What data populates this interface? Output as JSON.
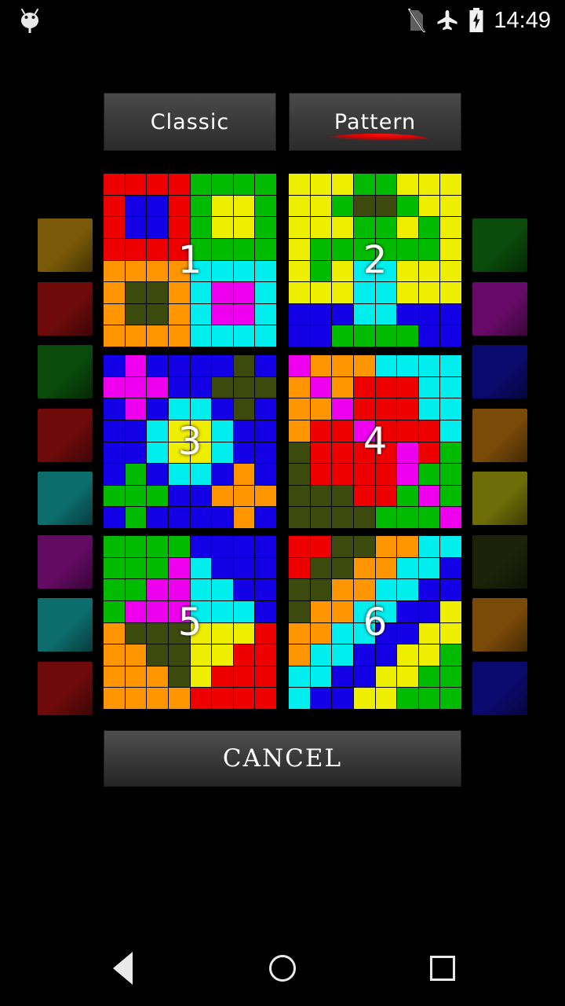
{
  "statusbar": {
    "time": "14:49",
    "icons": [
      "android-head-icon",
      "no-sim-icon",
      "airplane-mode-icon",
      "battery-charging-icon"
    ]
  },
  "tabs": [
    {
      "id": "classic",
      "label": "Classic",
      "active": false
    },
    {
      "id": "pattern",
      "label": "Pattern",
      "active": true
    }
  ],
  "footer": {
    "cancel_label": "CANCEL"
  },
  "navbar": {
    "back": "back-icon",
    "home": "home-icon",
    "recents": "recents-icon"
  },
  "colors": {
    "red": "#ee0000",
    "green": "#00bb00",
    "blue": "#1400e6",
    "yellow": "#eeee00",
    "orange": "#ff9500",
    "cyan": "#00eeee",
    "magenta": "#ee00ee",
    "olive": "#3d4a0e",
    "dark_olive": "#44500e",
    "tab_bg": "#3d3d3d",
    "accent_underline": "#d40000"
  },
  "palette_left": {
    "label": "left-color-palette",
    "swatches": [
      {
        "name": "swatch-dark-amber",
        "color": "#7a5a08"
      },
      {
        "name": "swatch-dark-red",
        "color": "#6e0a0a"
      },
      {
        "name": "swatch-dark-green",
        "color": "#0a4a0a"
      },
      {
        "name": "swatch-dark-red-2",
        "color": "#6e0a0a"
      },
      {
        "name": "swatch-teal",
        "color": "#0d6d6d"
      },
      {
        "name": "swatch-purple",
        "color": "#630a63"
      },
      {
        "name": "swatch-teal-2",
        "color": "#0d6d6d"
      },
      {
        "name": "swatch-dark-red-3",
        "color": "#6e0a0a"
      }
    ]
  },
  "palette_right": {
    "label": "right-color-palette",
    "swatches": [
      {
        "name": "swatch-dark-green",
        "color": "#0a4a0a"
      },
      {
        "name": "swatch-purple",
        "color": "#670a67"
      },
      {
        "name": "swatch-navy",
        "color": "#0a0a6e"
      },
      {
        "name": "swatch-brown",
        "color": "#7a4a08"
      },
      {
        "name": "swatch-olive-yellow",
        "color": "#6e6e08"
      },
      {
        "name": "swatch-very-dark-olive",
        "color": "#1c2208"
      },
      {
        "name": "swatch-brown-2",
        "color": "#7a4a08"
      },
      {
        "name": "swatch-navy-2",
        "color": "#0a0a6e"
      }
    ]
  },
  "puzzles": [
    {
      "number": "1",
      "name": "puzzle-thumbnail-1",
      "rows": [
        [
          "red",
          "red",
          "red",
          "red",
          "green",
          "green",
          "green",
          "green"
        ],
        [
          "red",
          "blue",
          "blue",
          "red",
          "green",
          "yellow",
          "yellow",
          "green"
        ],
        [
          "red",
          "blue",
          "blue",
          "red",
          "green",
          "yellow",
          "yellow",
          "green"
        ],
        [
          "red",
          "red",
          "red",
          "red",
          "green",
          "green",
          "green",
          "green"
        ],
        [
          "orange",
          "orange",
          "orange",
          "orange",
          "cyan",
          "cyan",
          "cyan",
          "cyan"
        ],
        [
          "orange",
          "olive",
          "olive",
          "orange",
          "cyan",
          "magenta",
          "magenta",
          "cyan"
        ],
        [
          "orange",
          "olive",
          "olive",
          "orange",
          "cyan",
          "magenta",
          "magenta",
          "cyan"
        ],
        [
          "orange",
          "orange",
          "orange",
          "orange",
          "cyan",
          "cyan",
          "cyan",
          "cyan"
        ]
      ]
    },
    {
      "number": "2",
      "name": "puzzle-thumbnail-2",
      "rows": [
        [
          "yellow",
          "yellow",
          "yellow",
          "green",
          "green",
          "yellow",
          "yellow",
          "yellow"
        ],
        [
          "yellow",
          "yellow",
          "green",
          "olive",
          "olive",
          "green",
          "yellow",
          "yellow"
        ],
        [
          "yellow",
          "yellow",
          "yellow",
          "green",
          "green",
          "yellow",
          "green",
          "yellow"
        ],
        [
          "yellow",
          "green",
          "green",
          "green",
          "green",
          "green",
          "green",
          "yellow"
        ],
        [
          "yellow",
          "green",
          "yellow",
          "cyan",
          "cyan",
          "yellow",
          "yellow",
          "yellow"
        ],
        [
          "yellow",
          "yellow",
          "yellow",
          "cyan",
          "cyan",
          "yellow",
          "yellow",
          "yellow"
        ],
        [
          "blue",
          "blue",
          "blue",
          "cyan",
          "cyan",
          "blue",
          "blue",
          "blue"
        ],
        [
          "blue",
          "blue",
          "green",
          "green",
          "green",
          "green",
          "blue",
          "blue"
        ]
      ]
    },
    {
      "number": "3",
      "name": "puzzle-thumbnail-3",
      "rows": [
        [
          "blue",
          "magenta",
          "blue",
          "blue",
          "blue",
          "blue",
          "olive",
          "blue"
        ],
        [
          "magenta",
          "magenta",
          "magenta",
          "blue",
          "blue",
          "olive",
          "olive",
          "olive"
        ],
        [
          "blue",
          "magenta",
          "blue",
          "cyan",
          "cyan",
          "blue",
          "olive",
          "blue"
        ],
        [
          "blue",
          "blue",
          "cyan",
          "yellow",
          "yellow",
          "cyan",
          "blue",
          "blue"
        ],
        [
          "blue",
          "blue",
          "cyan",
          "yellow",
          "yellow",
          "cyan",
          "blue",
          "blue"
        ],
        [
          "blue",
          "green",
          "blue",
          "cyan",
          "cyan",
          "blue",
          "orange",
          "blue"
        ],
        [
          "green",
          "green",
          "green",
          "blue",
          "blue",
          "orange",
          "orange",
          "orange"
        ],
        [
          "blue",
          "green",
          "blue",
          "blue",
          "blue",
          "blue",
          "orange",
          "blue"
        ]
      ]
    },
    {
      "number": "4",
      "name": "puzzle-thumbnail-4",
      "rows": [
        [
          "magenta",
          "orange",
          "orange",
          "orange",
          "cyan",
          "cyan",
          "cyan",
          "cyan"
        ],
        [
          "orange",
          "magenta",
          "orange",
          "red",
          "red",
          "red",
          "cyan",
          "cyan"
        ],
        [
          "orange",
          "orange",
          "magenta",
          "red",
          "red",
          "red",
          "cyan",
          "cyan"
        ],
        [
          "orange",
          "red",
          "red",
          "magenta",
          "red",
          "red",
          "red",
          "cyan"
        ],
        [
          "olive",
          "red",
          "red",
          "red",
          "red",
          "magenta",
          "red",
          "green"
        ],
        [
          "olive",
          "red",
          "red",
          "red",
          "red",
          "magenta",
          "green",
          "green"
        ],
        [
          "olive",
          "olive",
          "olive",
          "red",
          "red",
          "green",
          "magenta",
          "green"
        ],
        [
          "olive",
          "olive",
          "olive",
          "olive",
          "green",
          "green",
          "green",
          "magenta"
        ]
      ]
    },
    {
      "number": "5",
      "name": "puzzle-thumbnail-5",
      "rows": [
        [
          "green",
          "green",
          "green",
          "green",
          "blue",
          "blue",
          "blue",
          "blue"
        ],
        [
          "green",
          "green",
          "green",
          "magenta",
          "cyan",
          "blue",
          "blue",
          "blue"
        ],
        [
          "green",
          "green",
          "magenta",
          "magenta",
          "cyan",
          "cyan",
          "blue",
          "blue"
        ],
        [
          "green",
          "magenta",
          "magenta",
          "magenta",
          "cyan",
          "cyan",
          "cyan",
          "blue"
        ],
        [
          "orange",
          "olive",
          "olive",
          "olive",
          "yellow",
          "yellow",
          "yellow",
          "red"
        ],
        [
          "orange",
          "orange",
          "olive",
          "olive",
          "yellow",
          "yellow",
          "red",
          "red"
        ],
        [
          "orange",
          "orange",
          "orange",
          "olive",
          "yellow",
          "red",
          "red",
          "red"
        ],
        [
          "orange",
          "orange",
          "orange",
          "orange",
          "red",
          "red",
          "red",
          "red"
        ]
      ]
    },
    {
      "number": "6",
      "name": "puzzle-thumbnail-6",
      "rows": [
        [
          "red",
          "red",
          "olive",
          "olive",
          "orange",
          "orange",
          "cyan",
          "cyan"
        ],
        [
          "red",
          "olive",
          "olive",
          "orange",
          "orange",
          "cyan",
          "cyan",
          "blue"
        ],
        [
          "olive",
          "olive",
          "orange",
          "orange",
          "cyan",
          "cyan",
          "blue",
          "blue"
        ],
        [
          "olive",
          "orange",
          "orange",
          "cyan",
          "cyan",
          "blue",
          "blue",
          "yellow"
        ],
        [
          "orange",
          "orange",
          "cyan",
          "cyan",
          "blue",
          "blue",
          "yellow",
          "yellow"
        ],
        [
          "orange",
          "cyan",
          "cyan",
          "blue",
          "blue",
          "yellow",
          "yellow",
          "green"
        ],
        [
          "cyan",
          "cyan",
          "blue",
          "blue",
          "yellow",
          "yellow",
          "green",
          "green"
        ],
        [
          "cyan",
          "blue",
          "blue",
          "yellow",
          "yellow",
          "green",
          "green",
          "green"
        ]
      ]
    }
  ]
}
